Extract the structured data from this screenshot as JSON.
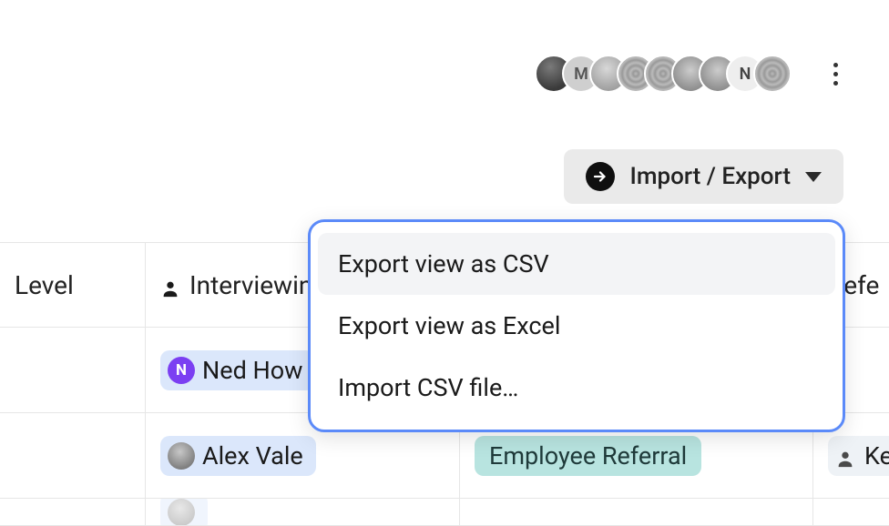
{
  "topbar": {
    "avatars": [
      {
        "kind": "bwphoto",
        "label": ""
      },
      {
        "kind": "gray-light",
        "label": "M"
      },
      {
        "kind": "gray-photo1",
        "label": ""
      },
      {
        "kind": "gray-pattern",
        "label": ""
      },
      {
        "kind": "gray-pattern",
        "label": ""
      },
      {
        "kind": "gray-photo2",
        "label": ""
      },
      {
        "kind": "gray-photo2",
        "label": ""
      },
      {
        "kind": "off-white",
        "label": "N"
      },
      {
        "kind": "gray-pattern",
        "label": ""
      }
    ]
  },
  "import_export": {
    "label": "Import / Export",
    "menu": [
      {
        "label": "Export view as CSV",
        "highlighted": true
      },
      {
        "label": "Export view as Excel",
        "highlighted": false
      },
      {
        "label": "Import CSV file…",
        "highlighted": false
      }
    ]
  },
  "table": {
    "columns": {
      "level": "Level",
      "interviewing": "Interviewing",
      "source_visible": "",
      "referred": "Refe"
    },
    "rows": [
      {
        "interviewer": {
          "name": "Ned How",
          "avatar_letter": "N",
          "avatar_class": "purple"
        },
        "source": "",
        "referred": ""
      },
      {
        "interviewer": {
          "name": "Alex Vale",
          "avatar_letter": "",
          "avatar_class": "photo"
        },
        "source": "Employee Referral",
        "referred": "Kev"
      },
      {
        "interviewer": {
          "name": "",
          "avatar_letter": "",
          "avatar_class": "photo"
        },
        "source": "",
        "referred": ""
      }
    ]
  }
}
